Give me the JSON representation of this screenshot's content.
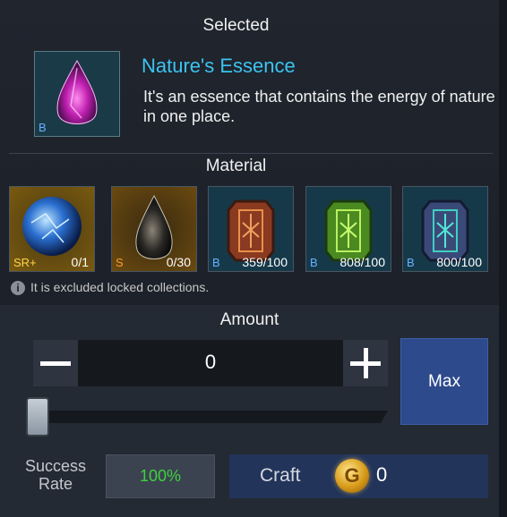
{
  "selected": {
    "header": "Selected",
    "item_name": "Nature's Essence",
    "item_desc": "It's an essence that contains the energy of nature in one place.",
    "item_grade": "B",
    "item_icon": "pink-crystal-drop-icon"
  },
  "material": {
    "header": "Material",
    "items": [
      {
        "grade": "SR+",
        "count": "0/1",
        "icon": "blue-orb-icon",
        "grade_color": "#ffd54a"
      },
      {
        "grade": "S",
        "count": "0/30",
        "icon": "dark-drop-icon",
        "grade_color": "#ff9c2a"
      },
      {
        "grade": "B",
        "count": "359/100",
        "icon": "orange-rune-card-icon",
        "grade_color": "#6ab0ff"
      },
      {
        "grade": "B",
        "count": "808/100",
        "icon": "green-rune-card-icon",
        "grade_color": "#6ab0ff"
      },
      {
        "grade": "B",
        "count": "800/100",
        "icon": "teal-rune-card-icon",
        "grade_color": "#6ab0ff"
      }
    ],
    "note": "It is excluded locked collections."
  },
  "amount": {
    "header": "Amount",
    "value": "0",
    "max_label": "Max",
    "slider_fraction": 0
  },
  "success": {
    "label": "Success Rate",
    "value": "100%"
  },
  "craft": {
    "label": "Craft",
    "cost": "0",
    "coin_letter": "G"
  },
  "colors": {
    "accent_name": "#3cc3f0",
    "success_green": "#3fd13f",
    "max_button": "#2d4a8c",
    "craft_button": "#22345a"
  }
}
